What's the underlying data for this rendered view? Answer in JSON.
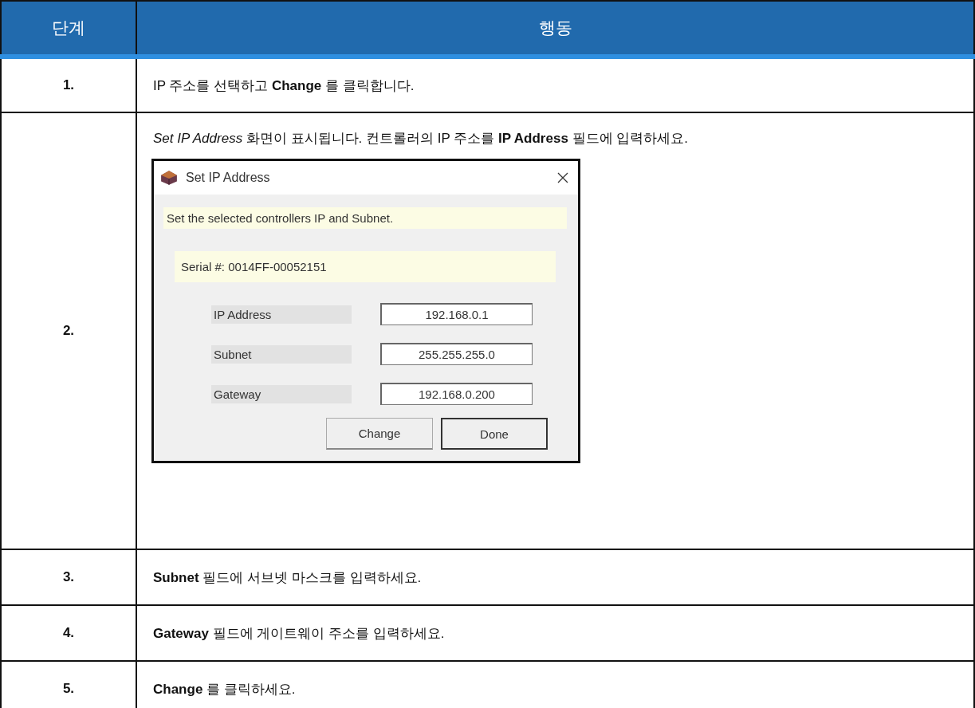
{
  "table": {
    "columns": [
      "단계",
      "행동"
    ],
    "rows": [
      {
        "step": "1.",
        "action": "IP 주소를 선택하고 **Change** 를 클릭합니다."
      },
      {
        "step": "2.",
        "action": "*Set IP Address* 화면이 표시됩니다. 컨트롤러의 IP 주소를 **IP Address** 필드에 입력하세요.",
        "dialog": {
          "title": "Set IP Address",
          "message": "Set the selected controllers IP and Subnet.",
          "serial": "Serial #: 0014FF-00052151",
          "fields": [
            {
              "label": "IP Address",
              "value": "192.168.0.1"
            },
            {
              "label": "Subnet",
              "value": "255.255.255.0"
            },
            {
              "label": "Gateway",
              "value": "192.168.0.200"
            }
          ],
          "buttons": [
            {
              "label": "Change",
              "default": false
            },
            {
              "label": "Done",
              "default": true
            }
          ]
        }
      },
      {
        "step": "3.",
        "action": "**Subnet** 필드에 서브넷 마스크를 입력하세요."
      },
      {
        "step": "4.",
        "action": "**Gateway** 필드에 게이트웨이 주소를 입력하세요."
      },
      {
        "step": "5.",
        "action": "**Change** 를 클릭하세요."
      }
    ]
  }
}
